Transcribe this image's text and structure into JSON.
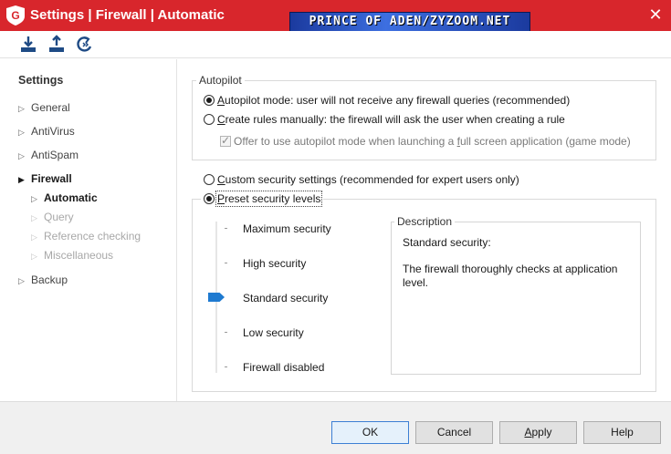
{
  "window": {
    "title": "Settings | Firewall | Automatic",
    "watermark": "PRINCE OF ADEN/ZYZOOM.NET",
    "colors": {
      "titlebar": "#d8262c",
      "accent": "#1e7ad0"
    }
  },
  "toolbar": {
    "icons": [
      "import-icon",
      "export-icon",
      "restore-default-icon"
    ]
  },
  "sidebar": {
    "heading": "Settings",
    "items": [
      {
        "label": "General",
        "state": "collapsed"
      },
      {
        "label": "AntiVirus",
        "state": "collapsed"
      },
      {
        "label": "AntiSpam",
        "state": "collapsed"
      },
      {
        "label": "Firewall",
        "state": "expanded"
      },
      {
        "label": "Automatic",
        "state": "selected"
      },
      {
        "label": "Query",
        "state": "disabled"
      },
      {
        "label": "Reference checking",
        "state": "disabled"
      },
      {
        "label": "Miscellaneous",
        "state": "disabled"
      },
      {
        "label": "Backup",
        "state": "collapsed"
      }
    ]
  },
  "autopilot": {
    "legend": "Autopilot",
    "option_autopilot_pre": "A",
    "option_autopilot_post": "utopilot mode: user will not receive any firewall queries (recommended)",
    "option_manual_pre": "C",
    "option_manual_post": "reate rules manually: the firewall will ask the user when creating a rule",
    "offer_pre": "Offer to use autopilot mode when launching a ",
    "offer_acc": "f",
    "offer_post": "ull screen application (game mode)",
    "selected": "autopilot",
    "offer_checked": true
  },
  "security": {
    "custom_pre": "C",
    "custom_post": "ustom security settings (recommended for expert users only)",
    "preset_pre": "P",
    "preset_post": "reset security levels",
    "selected": "preset",
    "levels": [
      "Maximum security",
      "High security",
      "Standard security",
      "Low security",
      "Firewall disabled"
    ],
    "current_level": "Standard security",
    "description_legend": "Description",
    "description_title": "Standard security:",
    "description_body": "The firewall thoroughly checks at application level."
  },
  "buttons": {
    "ok": "OK",
    "cancel": "Cancel",
    "apply_pre": "A",
    "apply_post": "pply",
    "help": "Help"
  }
}
